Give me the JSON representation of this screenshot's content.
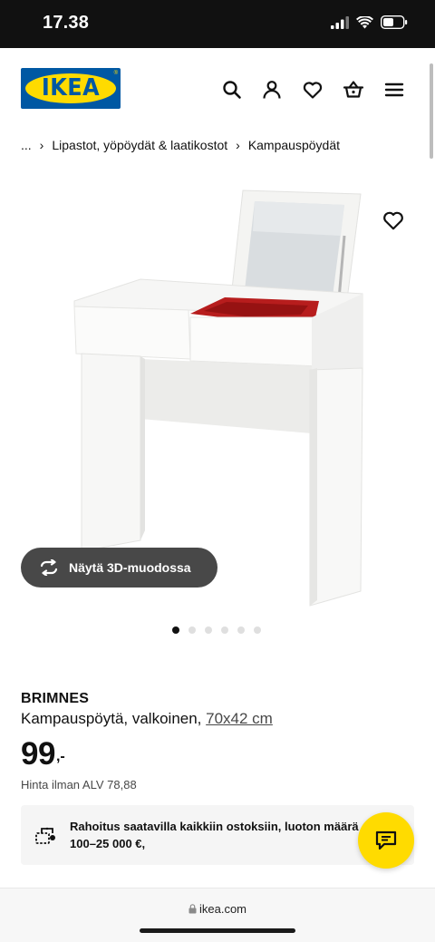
{
  "status_bar": {
    "time": "17.38"
  },
  "header": {
    "logo_text": "IKEA",
    "logo_colors": {
      "blue": "#0058A3",
      "yellow": "#FFDB00"
    },
    "icons": [
      "search-icon",
      "user-icon",
      "heart-icon",
      "basket-icon",
      "menu-icon"
    ]
  },
  "breadcrumb": {
    "items": [
      "...",
      "Lipastot, yöpöydät & laatikostot",
      "Kampauspöydät"
    ]
  },
  "gallery": {
    "view_3d_label": "Näytä 3D-muodossa",
    "dot_count": 6,
    "active_index": 0
  },
  "product": {
    "brand": "BRIMNES",
    "description": "Kampauspöytä, valkoinen,",
    "size": "70x42 cm",
    "price_integer": "99",
    "price_suffix": ",-",
    "vat_text": "Hinta ilman ALV 78,88"
  },
  "finance": {
    "text": "Rahoitus saatavilla kaikkiin ostoksiin, luoton määrä 100–25 000 €,"
  },
  "chat": {
    "color": "#FFDB00"
  },
  "browser": {
    "url": "ikea.com"
  }
}
